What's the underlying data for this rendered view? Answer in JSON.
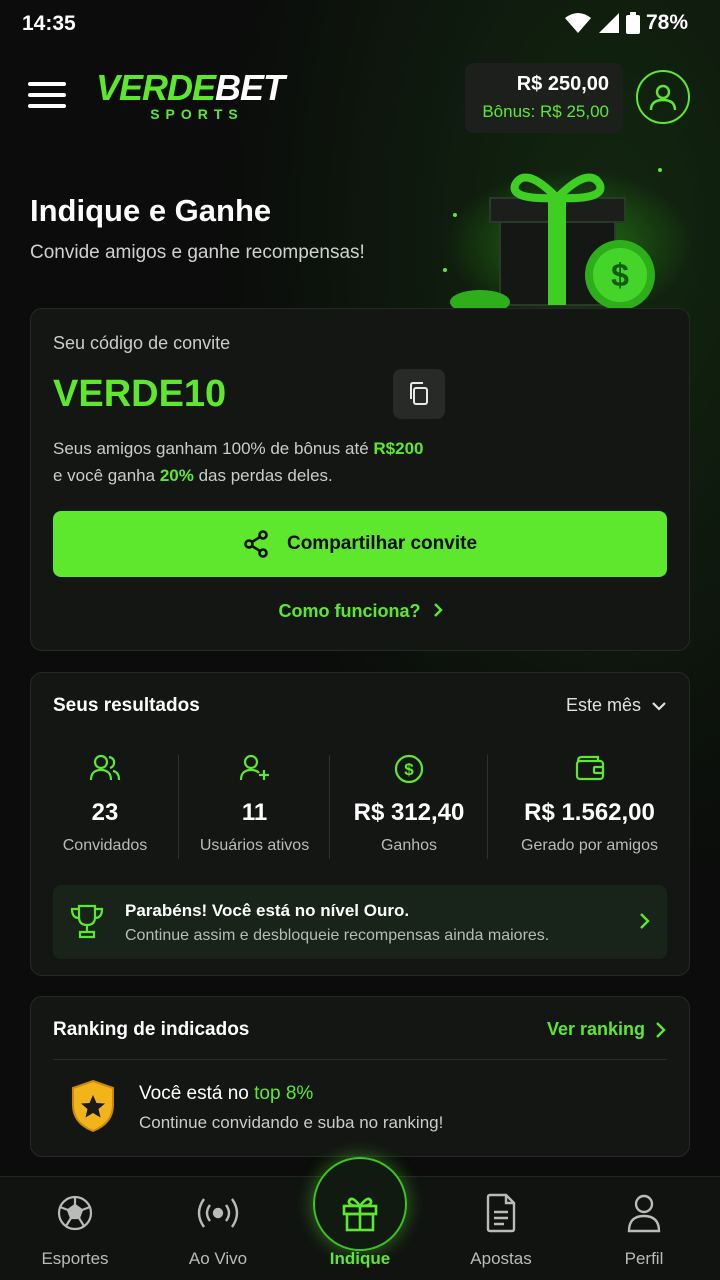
{
  "status_bar": {
    "time": "14:35",
    "battery": "78%"
  },
  "header": {
    "logo_main_1": "VERDE",
    "logo_main_2": "BET",
    "logo_sub": "SPORTS",
    "balance": "R$ 250,00",
    "bonus": "Bônus: R$ 25,00"
  },
  "hero": {
    "title": "Indique e Ganhe",
    "subtitle": "Convide amigos e ganhe recompensas!"
  },
  "invite": {
    "label": "Seu código de convite",
    "code": "VERDE10",
    "desc_1": "Seus amigos ganham 100% de bônus até ",
    "desc_1_highlight": "R$200",
    "desc_2": "e você ganha ",
    "desc_2_highlight": "20%",
    "desc_3": " das perdas deles.",
    "share_label": "Compartilhar convite",
    "how_label": "Como funciona?"
  },
  "results": {
    "title": "Seus resultados",
    "period": "Este mês",
    "stats": [
      {
        "icon": "users-icon",
        "value": "23",
        "caption": "Convidados"
      },
      {
        "icon": "user-plus-icon",
        "value": "11",
        "caption": "Usuários ativos"
      },
      {
        "icon": "dollar-circle-icon",
        "value": "R$ 312,40",
        "caption": "Ganhos"
      },
      {
        "icon": "wallet-icon",
        "value": "R$ 1.562,00",
        "caption": "Gerado por amigos"
      }
    ],
    "level_title": "Parabéns! Você está no nível Ouro.",
    "level_sub": "Continue assim e desbloqueie recompensas ainda maiores."
  },
  "ranking": {
    "title": "Ranking de indicados",
    "link": "Ver ranking",
    "line_1": "Você está no ",
    "line_1_highlight": "top 8%",
    "line_2": "Continue convidando e suba no ranking!"
  },
  "nav": [
    {
      "icon": "soccer-ball-icon",
      "label": "Esportes"
    },
    {
      "icon": "live-icon",
      "label": "Ao Vivo"
    },
    {
      "icon": "gift-icon",
      "label": "Indique"
    },
    {
      "icon": "document-icon",
      "label": "Apostas"
    },
    {
      "icon": "profile-icon",
      "label": "Perfil"
    }
  ],
  "colors": {
    "accent": "#5de82e",
    "background": "#0b0c0b",
    "card": "#141614",
    "gold": "#f2b31b"
  }
}
